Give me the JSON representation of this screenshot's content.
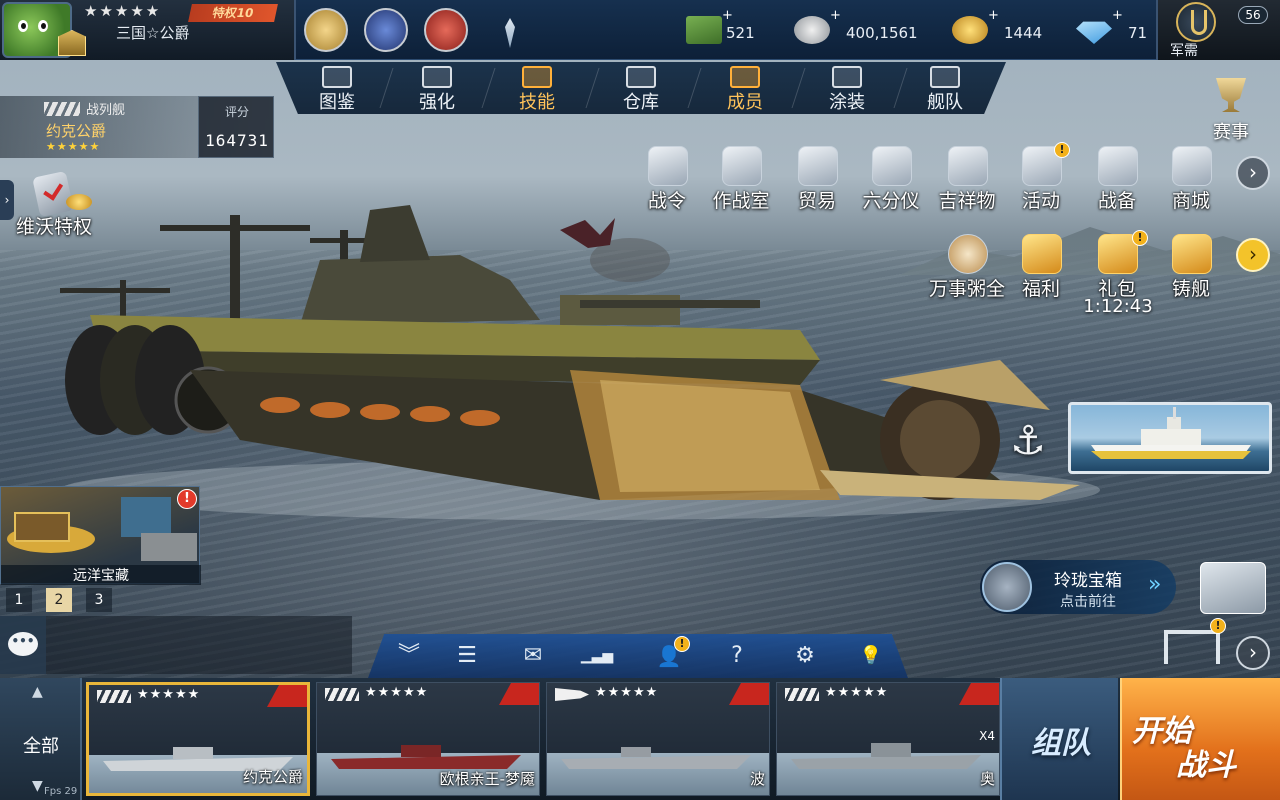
{
  "profile": {
    "name": "三国☆公爵",
    "stars": "★★★★★",
    "vip_label": "特权10"
  },
  "resources": [
    {
      "name": "cash",
      "icon": "cash-icon",
      "value": "521"
    },
    {
      "name": "silver",
      "icon": "silver-coin-icon",
      "value": "400,1561"
    },
    {
      "name": "gold",
      "icon": "gold-coin-icon",
      "value": "1444"
    },
    {
      "name": "diamond",
      "icon": "diamond-icon",
      "value": "71"
    }
  ],
  "resource_plus": "+",
  "junxu": {
    "label": "军需",
    "level": "56"
  },
  "nav": {
    "items": [
      {
        "label": "图鉴",
        "icon": "book-icon"
      },
      {
        "label": "强化",
        "icon": "upgrade-icon"
      },
      {
        "label": "技能",
        "icon": "skill-icon",
        "active": true
      },
      {
        "label": "仓库",
        "icon": "warehouse-icon"
      },
      {
        "label": "成员",
        "icon": "crew-icon"
      },
      {
        "label": "涂装",
        "icon": "paint-icon"
      },
      {
        "label": "舰队",
        "icon": "fleet-flag-icon"
      }
    ]
  },
  "ship_info": {
    "type": "战列舰",
    "name": "约克公爵",
    "stars": "★★★★★",
    "score_label": "评分",
    "score_value": "164731"
  },
  "weifu": {
    "label": "维沃特权"
  },
  "saishi": {
    "label": "赛事"
  },
  "features_row1": [
    {
      "label": "战令"
    },
    {
      "label": "作战室"
    },
    {
      "label": "贸易"
    },
    {
      "label": "六分仪"
    },
    {
      "label": "吉祥物"
    },
    {
      "label": "活动",
      "alert": "!"
    },
    {
      "label": "战备"
    },
    {
      "label": "商城"
    }
  ],
  "features_row2": [
    {
      "label": "万事粥全"
    },
    {
      "label": "福利"
    },
    {
      "label": "礼包",
      "alert": "!",
      "timer": "1:12:43"
    },
    {
      "label": "铸舰"
    }
  ],
  "arrow_glyph": "›",
  "anchor_glyph": "⚓",
  "treasure": {
    "label": "远洋宝藏",
    "alert": "!"
  },
  "pages": [
    "1",
    "2",
    "3"
  ],
  "active_page": "2",
  "chat": {
    "glyph": "•••"
  },
  "linglong": {
    "title": "玲珑宝箱",
    "subtitle": "点击前往",
    "arrow": "»"
  },
  "dock_alert": "!",
  "toolbar": {
    "buttons": [
      {
        "name": "collapse",
        "glyph": "︾"
      },
      {
        "name": "tasks",
        "glyph": "☰"
      },
      {
        "name": "mail",
        "glyph": "✉"
      },
      {
        "name": "ranking",
        "glyph": "▁▃▅"
      },
      {
        "name": "friends",
        "glyph": "👤"
      },
      {
        "name": "help",
        "glyph": "?"
      },
      {
        "name": "settings",
        "glyph": "⚙"
      },
      {
        "name": "tips",
        "glyph": "💡"
      }
    ],
    "friends_alert": "!"
  },
  "dock": {
    "all_label": "全部",
    "up": "▲",
    "down": "▼",
    "fps": "Fps 29",
    "ships": [
      {
        "name": "约克公爵",
        "stars": "★★★★★",
        "selected": true
      },
      {
        "name": "欧根亲王-梦魇",
        "stars": "★★★★★"
      },
      {
        "name": "波",
        "stars": "★★★★★"
      },
      {
        "name": "奥",
        "stars": "★★★★★",
        "extra": "X4"
      }
    ],
    "team_label": "组队",
    "start_line1": "开始",
    "start_line2": "战斗"
  }
}
